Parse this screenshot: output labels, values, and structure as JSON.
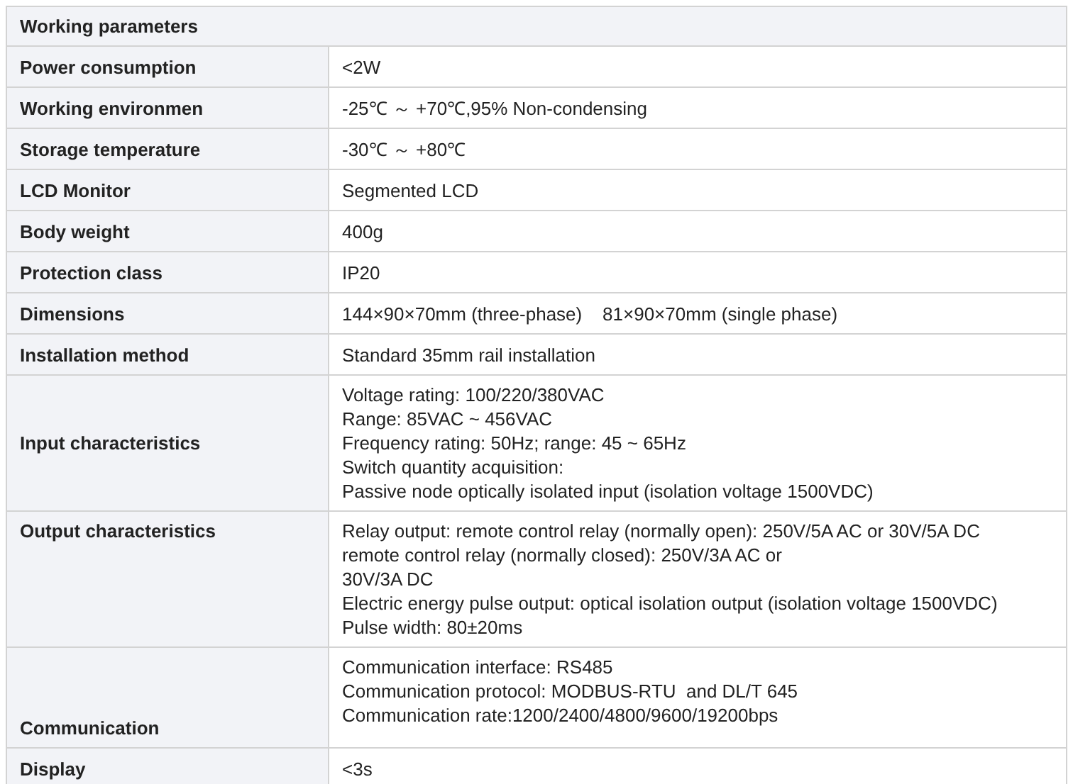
{
  "table": {
    "title": "Working parameters",
    "rows": [
      {
        "label": "Power consumption",
        "lines": [
          "<2W"
        ]
      },
      {
        "label": "Working environmen",
        "lines": [
          "-25℃ ～ +70℃,95% Non-condensing"
        ]
      },
      {
        "label": "Storage temperature",
        "lines": [
          "-30℃ ～ +80℃"
        ]
      },
      {
        "label": "LCD Monitor",
        "lines": [
          "Segmented LCD"
        ]
      },
      {
        "label": "Body weight",
        "lines": [
          "400g"
        ]
      },
      {
        "label": "Protection class",
        "lines": [
          "IP20"
        ]
      },
      {
        "label": "Dimensions",
        "lines": [
          "144×90×70mm (three-phase)    81×90×70mm (single phase)"
        ]
      },
      {
        "label": "Installation method",
        "lines": [
          "Standard 35mm rail installation"
        ]
      },
      {
        "label": "Input characteristics",
        "lines": [
          "Voltage rating: 100/220/380VAC",
          "Range: 85VAC ~ 456VAC",
          "Frequency rating: 50Hz; range: 45 ~ 65Hz",
          "Switch quantity acquisition:",
          "Passive node optically isolated input (isolation voltage 1500VDC)"
        ]
      },
      {
        "label": "Output characteristics",
        "lines": [
          "Relay output: remote control relay (normally open): 250V/5A AC or 30V/5A DC",
          "remote control relay (normally closed): 250V/3A AC or",
          "30V/3A DC",
          "Electric energy pulse output: optical isolation output (isolation voltage 1500VDC)",
          "Pulse width: 80±20ms"
        ]
      },
      {
        "label": "Communication",
        "lines": [
          "Communication interface: RS485",
          "Communication protocol: MODBUS-RTU  and DL/T 645",
          "Communication rate:1200/2400/4800/9600/19200bps"
        ]
      },
      {
        "label": "Display",
        "lines": [
          "<3s"
        ]
      }
    ]
  }
}
